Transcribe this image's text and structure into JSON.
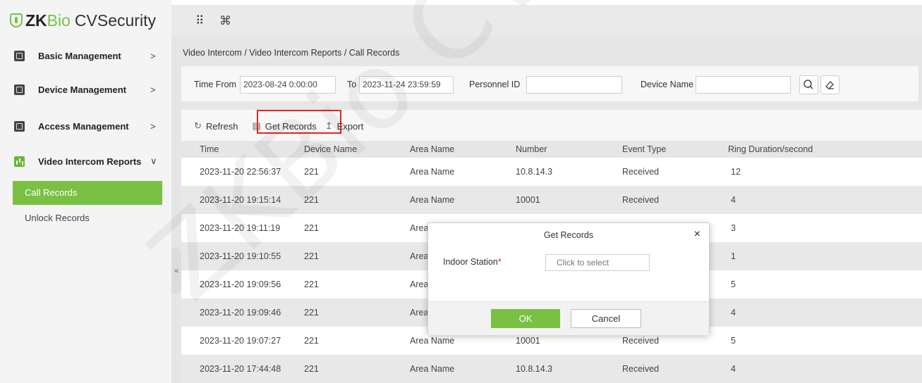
{
  "app": {
    "logo_prefix": "ZK",
    "logo_bio": "Bio",
    "logo_rest": "CVSecurity",
    "watermark": "ZKBio CV"
  },
  "topbar": {
    "apps_icon": "⠿",
    "shortcut_icon": "⌘"
  },
  "sidebar": {
    "items": [
      {
        "label": "Basic Management",
        "chevron": ">",
        "icon": "basic-management-icon"
      },
      {
        "label": "Device Management",
        "chevron": ">",
        "icon": "device-management-icon"
      },
      {
        "label": "Access Management",
        "chevron": ">",
        "icon": "access-management-icon"
      },
      {
        "label": "Video Intercom Reports",
        "chevron": "∨",
        "icon": "report-chart-icon"
      }
    ],
    "subitems": [
      {
        "label": "Call Records",
        "active": true
      },
      {
        "label": "Unlock Records",
        "active": false
      }
    ],
    "collapse": "«"
  },
  "breadcrumb": "Video Intercom / Video Intercom Reports / Call Records",
  "filters": {
    "time_from_label": "Time From",
    "time_from_value": "2023-08-24 0:00:00",
    "to_label": "To",
    "to_value": "2023-11-24 23:59:59",
    "personnel_label": "Personnel ID",
    "personnel_value": "",
    "device_label": "Device Name",
    "device_value": ""
  },
  "toolbar": {
    "refresh": "Refresh",
    "get_records": "Get Records",
    "export": "Export"
  },
  "table": {
    "headers": [
      "Time",
      "Device Name",
      "Area Name",
      "Number",
      "Event Type",
      "Ring Duration/second"
    ],
    "rows": [
      [
        "2023-11-20 22:56:37",
        "221",
        "Area Name",
        "10.8.14.3",
        "Received",
        "12"
      ],
      [
        "2023-11-20 19:15:14",
        "221",
        "Area Name",
        "10001",
        "Received",
        "4"
      ],
      [
        "2023-11-20 19:11:19",
        "221",
        "Area",
        "",
        "",
        "3"
      ],
      [
        "2023-11-20 19:10:55",
        "221",
        "Area",
        "",
        "",
        "1"
      ],
      [
        "2023-11-20 19:09:56",
        "221",
        "Area",
        "",
        "",
        "5"
      ],
      [
        "2023-11-20 19:09:46",
        "221",
        "Area",
        "",
        "",
        "4"
      ],
      [
        "2023-11-20 19:07:27",
        "221",
        "Area Name",
        "10001",
        "Received",
        "5"
      ],
      [
        "2023-11-20 17:44:48",
        "221",
        "Area Name",
        "10.8.14.3",
        "Received",
        "4"
      ]
    ]
  },
  "modal": {
    "title": "Get Records",
    "close": "×",
    "field_label": "Indoor Station",
    "required_mark": "*",
    "placeholder": "Click to select",
    "ok": "OK",
    "cancel": "Cancel"
  },
  "colors": {
    "accent": "#7ac143",
    "highlight": "#e52424"
  }
}
